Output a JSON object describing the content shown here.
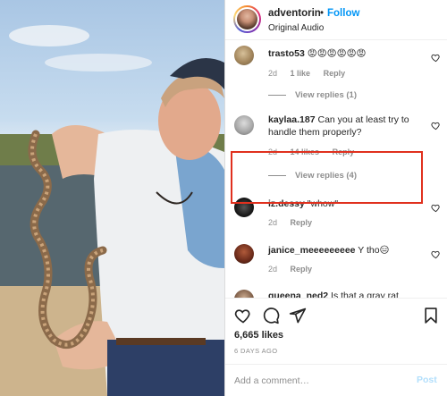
{
  "header": {
    "username": "adventorin",
    "separator": "•",
    "follow_label": "Follow",
    "audio": "Original Audio"
  },
  "comments": [
    {
      "username": "trasto53",
      "text": "😡😡😡😡😡😡",
      "age": "2d",
      "likes": "1 like",
      "reply_label": "Reply",
      "view_replies": "View replies (1)"
    },
    {
      "username": "kaylaa.187",
      "text": "Can you at least try to handle them properly?",
      "age": "2d",
      "likes": "14 likes",
      "reply_label": "Reply",
      "view_replies": "View replies (4)",
      "highlighted": true
    },
    {
      "username": "iz.dessy",
      "text": "\"whow\"",
      "age": "2d",
      "reply_label": "Reply"
    },
    {
      "username": "janice_meeeeeeeee",
      "text": "Y tho😑",
      "age": "2d",
      "reply_label": "Reply"
    },
    {
      "username": "gueena_ned2",
      "text": "Is that a gray rat",
      "partially_visible": true
    }
  ],
  "actions": {
    "likes": "6,665 likes",
    "date": "6 DAYS AGO",
    "comment_placeholder": "Add a comment…",
    "post_label": "Post"
  },
  "colors": {
    "accent": "#0095f6",
    "post_disabled": "#b2dffc",
    "highlight": "#e0301e",
    "muted": "#8e8e8e"
  },
  "icons": {
    "actions": [
      "heart-icon",
      "comment-icon",
      "share-icon",
      "bookmark-icon"
    ],
    "comment_like": "heart-icon"
  }
}
